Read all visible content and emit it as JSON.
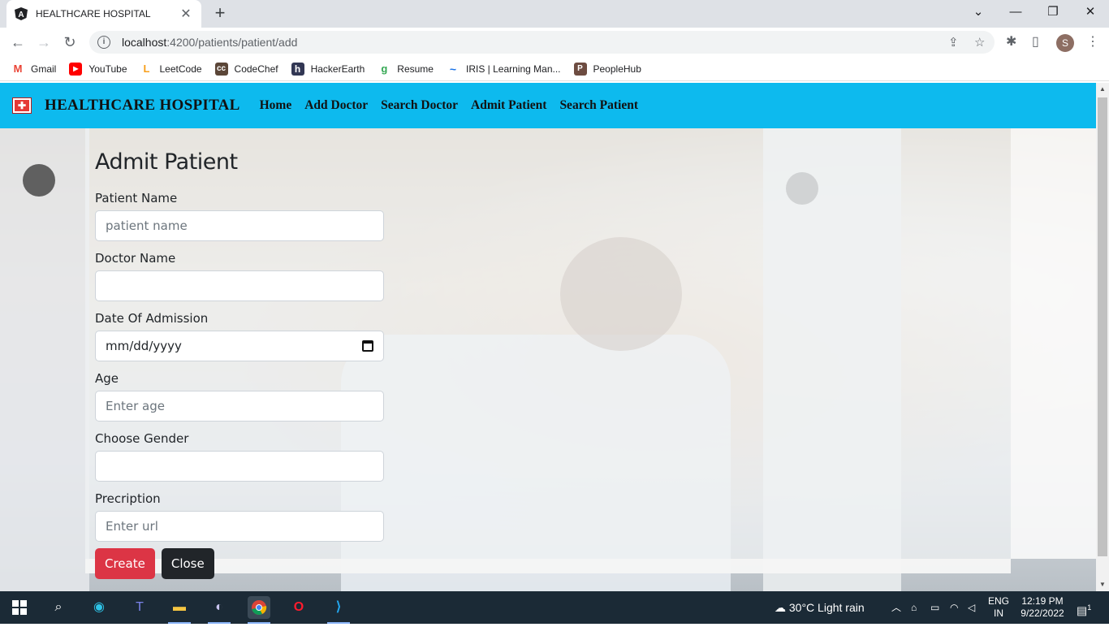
{
  "browser": {
    "tab_title": "HEALTHCARE HOSPITAL",
    "tab_close": "✕",
    "new_tab": "+",
    "url_host": "localhost",
    "url_rest": ":4200/patients/patient/add",
    "window_controls": {
      "chevron": "⌄",
      "minimize": "—",
      "restore": "❐",
      "close": "✕"
    },
    "profile_initial": "S",
    "bookmarks": [
      {
        "label": "Gmail",
        "icon": "M",
        "color": "#ea4335"
      },
      {
        "label": "YouTube",
        "icon": "▶",
        "color": "#ff0000"
      },
      {
        "label": "LeetCode",
        "icon": "L",
        "color": "#f89f1b"
      },
      {
        "label": "CodeChef",
        "icon": "cc",
        "color": "#5b4638"
      },
      {
        "label": "HackerEarth",
        "icon": "h",
        "color": "#323754"
      },
      {
        "label": "Resume",
        "icon": "g",
        "color": "#34a853"
      },
      {
        "label": "IRIS | Learning Man...",
        "icon": "~",
        "color": "#1a73e8"
      },
      {
        "label": "PeopleHub",
        "icon": "P",
        "color": "#6d4c41"
      }
    ]
  },
  "navbar": {
    "logo_glyph": "✚",
    "brand": "HEALTHCARE HOSPITAL",
    "links": [
      "Home",
      "Add Doctor",
      "Search Doctor",
      "Admit Patient",
      "Search Patient"
    ]
  },
  "form": {
    "title": "Admit Patient",
    "patient_name": {
      "label": "Patient Name",
      "placeholder": "patient name",
      "value": ""
    },
    "doctor_name": {
      "label": "Doctor Name",
      "value": ""
    },
    "date_of_admission": {
      "label": "Date Of Admission",
      "display": "mm/dd/yyyy"
    },
    "age": {
      "label": "Age",
      "placeholder": "Enter age",
      "value": ""
    },
    "gender": {
      "label": "Choose Gender",
      "value": ""
    },
    "prescription": {
      "label": "Precription",
      "placeholder": "Enter url",
      "value": ""
    },
    "create_label": "Create",
    "close_label": "Close"
  },
  "taskbar": {
    "weather": "30°C  Light rain",
    "lang_top": "ENG",
    "lang_bottom": "IN",
    "time": "12:19 PM",
    "date": "9/22/2022",
    "notifications": "1"
  }
}
